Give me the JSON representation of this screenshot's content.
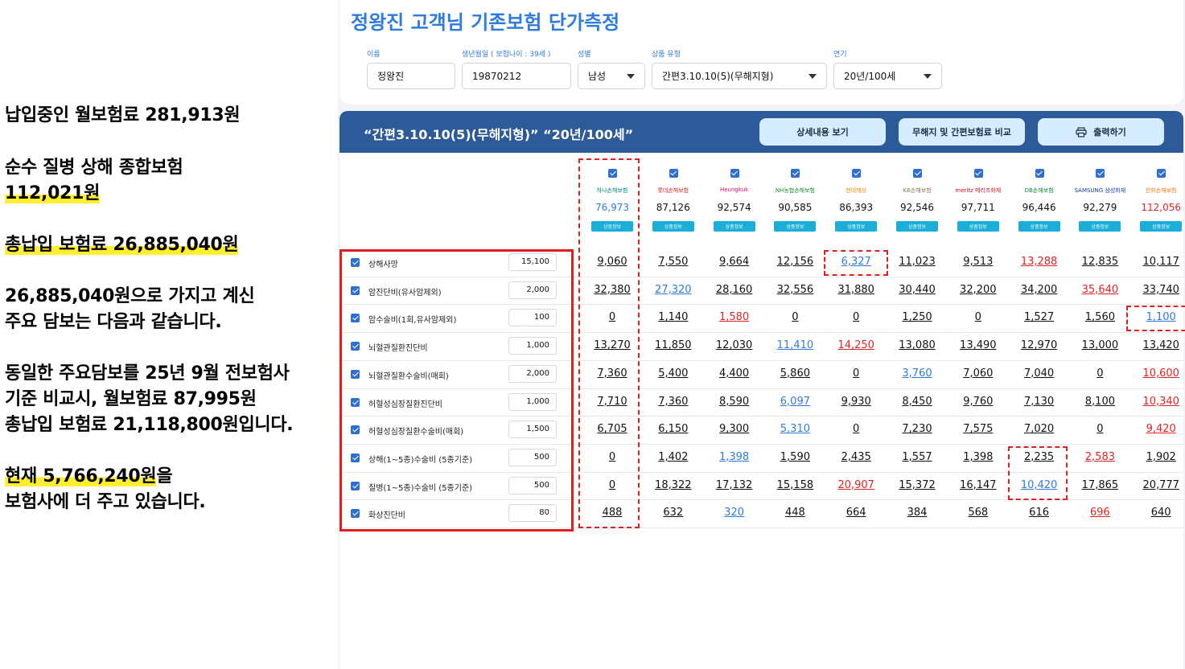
{
  "notes": {
    "line1": "납입중인 월보험료 281,913원",
    "line2": "순수 질병 상해 종합보험",
    "line3": "112,021원",
    "line4": "총납입 보험료 26,885,040원",
    "line5": "26,885,040원으로 가지고 계신",
    "line6": "주요 담보는 다음과 같습니다.",
    "line7": "동일한 주요담보를 25년 9월 전보험사",
    "line8": "기준 비교시, 월보험료 87,995원",
    "line9": "총납입 보험료 21,118,800원입니다.",
    "line10a": "현재 ",
    "line10b": "5,766,240원",
    "line10c": "을",
    "line11": "보험사에 더 주고 있습니다."
  },
  "header": {
    "title": "정왕진 고객님 기존보험 단가측정",
    "name_label": "이름",
    "name_value": "정왕진",
    "birth_label": "생년월일 ( 보험나이 : 39세 )",
    "birth_value": "19870212",
    "gender_label": "성별",
    "gender_value": "남성",
    "product_label": "상품 유형",
    "product_value": "간편3.10.10(5)(무해지형)",
    "term_label": "연기",
    "term_value": "20년/100세"
  },
  "bar": {
    "title": "“간편3.10.10(5)(무해지형)” “20년/100세”",
    "detail_btn": "상세내용 보기",
    "compare_btn": "무해지 및 간편보험료 비교",
    "print_btn": "출력하기"
  },
  "product_info_label": "상품정보",
  "insurers": [
    {
      "name": "하나손해보험",
      "premium": "76,973",
      "color": "#2f7be0",
      "logo_color": "#00857a"
    },
    {
      "name": "롯데손해보험",
      "premium": "87,126",
      "color": "#111111",
      "logo_color": "#e02424"
    },
    {
      "name": "Heungkuk",
      "premium": "92,574",
      "color": "#111111",
      "logo_color": "#d0106b"
    },
    {
      "name": "NH농협손해보험",
      "premium": "90,585",
      "color": "#111111",
      "logo_color": "#1f8a3a"
    },
    {
      "name": "현대해상",
      "premium": "86,393",
      "color": "#111111",
      "logo_color": "#f08a00"
    },
    {
      "name": "KB손해보험",
      "premium": "92,546",
      "color": "#111111",
      "logo_color": "#8a7a55"
    },
    {
      "name": "meritz 메리츠화재",
      "premium": "97,711",
      "color": "#111111",
      "logo_color": "#d8142a"
    },
    {
      "name": "DB손해보험",
      "premium": "96,446",
      "color": "#111111",
      "logo_color": "#0d8a3c"
    },
    {
      "name": "SAMSUNG 삼성화재",
      "premium": "92,279",
      "color": "#111111",
      "logo_color": "#1440a0"
    },
    {
      "name": "한화손해보험",
      "premium": "112,056",
      "color": "#e02424",
      "logo_color": "#f07c1a"
    }
  ],
  "coverages": [
    {
      "label": "상해사망",
      "amount": "15,100",
      "values": [
        "9,060",
        "7,550",
        "9,664",
        "12,156",
        "6,327",
        "11,023",
        "9,513",
        "13,288",
        "12,835",
        "10,117"
      ],
      "colors": [
        "k",
        "k",
        "k",
        "k",
        "b",
        "k",
        "k",
        "r",
        "k",
        "k"
      ]
    },
    {
      "label": "암진단비(유사암제외)",
      "amount": "2,000",
      "values": [
        "32,380",
        "27,320",
        "28,160",
        "32,556",
        "31,880",
        "30,440",
        "32,200",
        "34,200",
        "35,640",
        "33,740"
      ],
      "colors": [
        "k",
        "b",
        "k",
        "k",
        "k",
        "k",
        "k",
        "k",
        "r",
        "k"
      ]
    },
    {
      "label": "암수술비(1회,유사암제외)",
      "amount": "100",
      "values": [
        "0",
        "1,140",
        "1,580",
        "0",
        "0",
        "1,250",
        "0",
        "1,527",
        "1,560",
        "1,100"
      ],
      "colors": [
        "k",
        "k",
        "r",
        "k",
        "k",
        "k",
        "k",
        "k",
        "k",
        "b"
      ]
    },
    {
      "label": "뇌혈관질환진단비",
      "amount": "1,000",
      "values": [
        "13,270",
        "11,850",
        "12,030",
        "11,410",
        "14,250",
        "13,080",
        "13,490",
        "12,970",
        "13,000",
        "13,420"
      ],
      "colors": [
        "k",
        "k",
        "k",
        "b",
        "r",
        "k",
        "k",
        "k",
        "k",
        "k"
      ]
    },
    {
      "label": "뇌혈관질환수술비(매회)",
      "amount": "2,000",
      "values": [
        "7,360",
        "5,400",
        "4,400",
        "5,860",
        "0",
        "3,760",
        "7,060",
        "7,040",
        "0",
        "10,600"
      ],
      "colors": [
        "k",
        "k",
        "k",
        "k",
        "k",
        "b",
        "k",
        "k",
        "k",
        "r"
      ]
    },
    {
      "label": "허혈성심장질환진단비",
      "amount": "1,000",
      "values": [
        "7,710",
        "7,360",
        "8,590",
        "6,097",
        "9,930",
        "8,450",
        "9,760",
        "7,130",
        "8,100",
        "10,340"
      ],
      "colors": [
        "k",
        "k",
        "k",
        "b",
        "k",
        "k",
        "k",
        "k",
        "k",
        "r"
      ]
    },
    {
      "label": "허혈성심장질환수술비(매회)",
      "amount": "1,500",
      "values": [
        "6,705",
        "6,150",
        "9,300",
        "5,310",
        "0",
        "7,230",
        "7,575",
        "7,020",
        "0",
        "9,420"
      ],
      "colors": [
        "k",
        "k",
        "k",
        "b",
        "k",
        "k",
        "k",
        "k",
        "k",
        "r"
      ]
    },
    {
      "label": "상해(1~5종)수술비 (5종기준)",
      "amount": "500",
      "values": [
        "0",
        "1,402",
        "1,398",
        "1,590",
        "2,435",
        "1,557",
        "1,398",
        "2,235",
        "2,583",
        "1,902"
      ],
      "colors": [
        "k",
        "k",
        "b",
        "k",
        "k",
        "k",
        "k",
        "k",
        "r",
        "k"
      ]
    },
    {
      "label": "질병(1~5종)수술비 (5종기준)",
      "amount": "500",
      "values": [
        "0",
        "18,322",
        "17,132",
        "15,158",
        "20,907",
        "15,372",
        "16,147",
        "10,420",
        "17,865",
        "20,777"
      ],
      "colors": [
        "k",
        "k",
        "k",
        "k",
        "r",
        "k",
        "k",
        "b",
        "k",
        "k"
      ]
    },
    {
      "label": "화상진단비",
      "amount": "80",
      "values": [
        "488",
        "632",
        "320",
        "448",
        "664",
        "384",
        "568",
        "616",
        "696",
        "640"
      ],
      "colors": [
        "k",
        "k",
        "b",
        "k",
        "k",
        "k",
        "k",
        "k",
        "r",
        "k"
      ]
    }
  ]
}
